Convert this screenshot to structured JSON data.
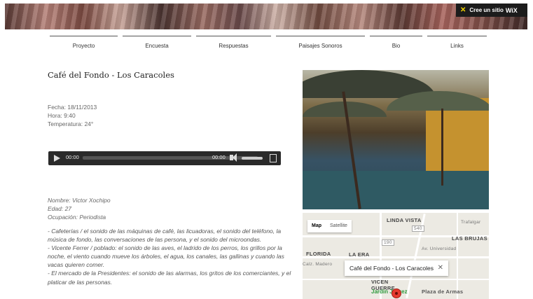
{
  "banner": {
    "wix_label": "Cree un sitio",
    "wix_brand": "WiX",
    "wix_glyph": "✕"
  },
  "nav": [
    "Proyecto",
    "Encuesta",
    "Respuestas",
    "Paisajes Sonoros",
    "Bio",
    "Links"
  ],
  "page": {
    "title": "Café del Fondo - Los Caracoles",
    "fecha": "Fecha: 18/11/2013",
    "hora": "Hora: 9:40",
    "temperatura": "Temperatura: 24°"
  },
  "player": {
    "current": "00:00",
    "duration": "00:00",
    "progress": 0,
    "volume": 0.9
  },
  "interviewee": {
    "nombre": "Nombre: Victor Xochipo",
    "edad": "Edad: 27",
    "ocupacion": "Ocupación: Periodista"
  },
  "responses": [
    "- Cafeterías / el sonido de las máquinas de café, las licuadoras, el sonido del teléfono, la música de fondo, las conversaciones de las persona, y el sonido del microondas.",
    "- Vicente Ferrer / poblado: el sonido de las aves, el ladrido de los perros, los grillos por la noche, el viento cuando mueve los árboles, el agua, los canales, las gallinas y cuando las vacas quieren comer.",
    "- El mercado de la Presidentes: el sonido de las alarmas, los gritos de los comerciantes, y el platicar de las personas."
  ],
  "map": {
    "type_map": "Map",
    "type_satellite": "Satellite",
    "info_title": "Café del Fondo - Los Caracoles",
    "info_close": "✕",
    "labels": {
      "linda_vista": "LINDA VISTA",
      "las_brujas": "LAS BRUJAS",
      "florida": "FLORIDA",
      "la_era": "LA ERA",
      "guerrero": "GUERRE",
      "calle": "Trafalgar",
      "road_540": "540",
      "road_190": "190",
      "jardin": "Jardín Juárez",
      "plaza": "Plaza de Armas",
      "av": "Av. Universidad",
      "calzada": "Calz. Madero",
      "vicente": "VICEN"
    }
  }
}
